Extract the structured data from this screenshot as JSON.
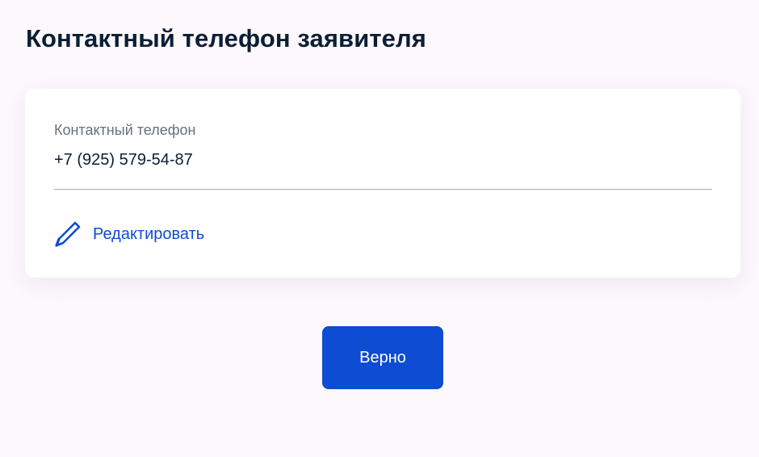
{
  "page": {
    "title": "Контактный телефон заявителя"
  },
  "contact": {
    "label": "Контактный телефон",
    "value": "+7 (925) 579-54-87"
  },
  "edit": {
    "label": "Редактировать",
    "icon": "pencil-icon"
  },
  "actions": {
    "confirm_label": "Верно"
  },
  "colors": {
    "accent": "#0d4cd3",
    "text": "#0b1f33",
    "muted": "#66727f",
    "background": "#fcf8fc"
  }
}
